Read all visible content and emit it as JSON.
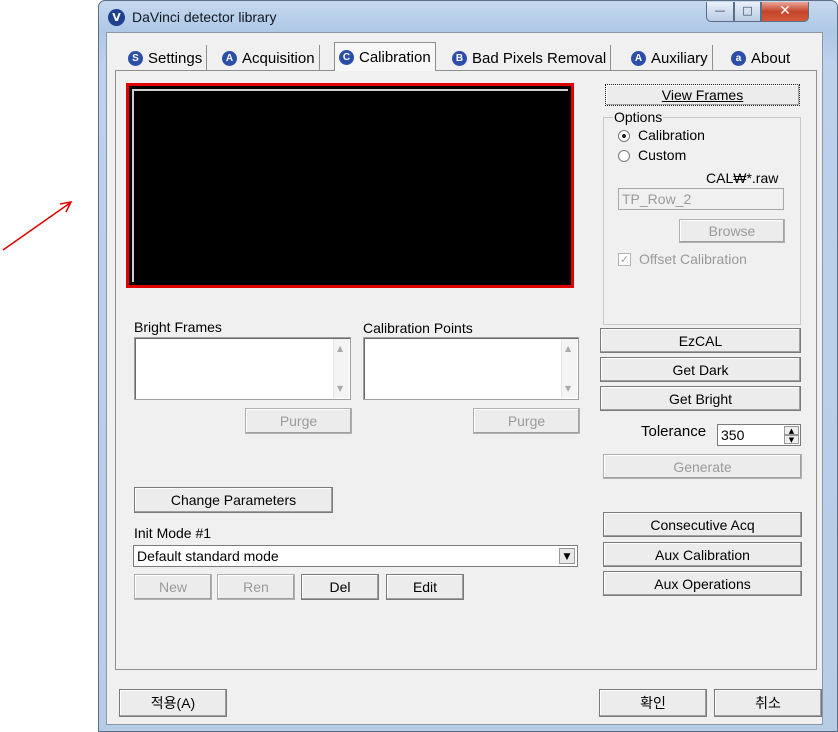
{
  "window": {
    "title": "DaVinci detector library",
    "icon_letter": "V"
  },
  "titlebar_buttons": {
    "minimize": "—",
    "maximize": "□",
    "close": "✕"
  },
  "tabs": [
    {
      "icon": "S",
      "label": "Settings"
    },
    {
      "icon": "A",
      "label": "Acquisition"
    },
    {
      "icon": "C",
      "label": "Calibration"
    },
    {
      "icon": "B",
      "label": "Bad Pixels Removal"
    },
    {
      "icon": "A",
      "label": "Auxiliary"
    },
    {
      "icon": "a",
      "label": "About"
    }
  ],
  "active_tab": "Calibration",
  "calibration": {
    "view_frames": "View Frames",
    "options": {
      "group_label": "Options",
      "radio_calibration": "Calibration",
      "radio_custom": "Custom",
      "file_filter": "CAL₩*.raw",
      "file_value": "TP_Row_2",
      "browse": "Browse",
      "offset_calibration": "Offset Calibration"
    },
    "bright_frames_label": "Bright Frames",
    "calibration_points_label": "Calibration Points",
    "purge_left": "Purge",
    "purge_right": "Purge",
    "ezcal": "EzCAL",
    "get_dark": "Get Dark",
    "get_bright": "Get Bright",
    "tolerance_label": "Tolerance",
    "tolerance_value": "350",
    "generate": "Generate",
    "change_parameters": "Change Parameters",
    "init_mode_label": "Init Mode #1",
    "init_mode_value": "Default standard mode",
    "new": "New",
    "ren": "Ren",
    "del": "Del",
    "edit": "Edit",
    "consecutive_acq": "Consecutive Acq",
    "aux_calibration": "Aux Calibration",
    "aux_operations": "Aux Operations"
  },
  "footer": {
    "apply": "적용(A)",
    "ok": "확인",
    "cancel": "취소"
  },
  "colors": {
    "image_border": "#e00000",
    "arrow": "#e00000",
    "tab_icon": "#2c4ea8"
  }
}
